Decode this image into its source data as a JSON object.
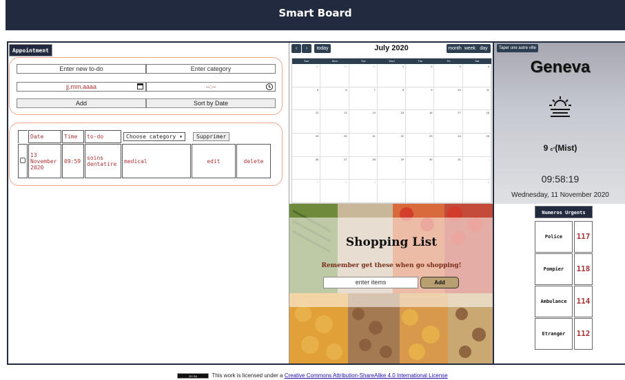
{
  "header": {
    "title": "Smart Board"
  },
  "appointment": {
    "tab_label": "Appointment",
    "todo_placeholder": "Enter new to-do",
    "category_placeholder": "Enter category",
    "date_placeholder": "jj.mm.aaaa",
    "time_placeholder": "--:--",
    "add_label": "Add",
    "sort_label": "Sort by Date",
    "table": {
      "headers": [
        "Date",
        "Time",
        "to-do"
      ],
      "category_select": "Choose category",
      "delete_all_label": "Supprimer",
      "rows": [
        {
          "date": "13 November 2020",
          "time": "09:59",
          "todo": "soins dentatire",
          "category": "medical",
          "edit": "edit",
          "delete": "delete"
        }
      ]
    }
  },
  "calendar": {
    "title": "July 2020",
    "prev_icon": "chevron-left-icon",
    "next_icon": "chevron-right-icon",
    "today_label": "today",
    "views": [
      "month",
      "week",
      "day"
    ],
    "weekdays": [
      "Sun",
      "Mon",
      "Tue",
      "Wed",
      "Thu",
      "Fri",
      "Sat"
    ],
    "weeks": [
      [
        "28",
        "29",
        "30",
        "1",
        "2",
        "3",
        "4"
      ],
      [
        "5",
        "6",
        "7",
        "8",
        "9",
        "10",
        "11"
      ],
      [
        "12",
        "13",
        "14",
        "15",
        "16",
        "17",
        "18"
      ],
      [
        "19",
        "20",
        "21",
        "22",
        "23",
        "24",
        "25"
      ],
      [
        "26",
        "27",
        "28",
        "29",
        "30",
        "31",
        "1"
      ],
      [
        "2",
        "3",
        "4",
        "5",
        "6",
        "7",
        "8"
      ]
    ]
  },
  "weather": {
    "city_button": "Taper une autre ville",
    "city": "Geneva",
    "icon": "sun-haze-icon",
    "temp_value": "9",
    "temp_unit": "c°",
    "condition": "Mist",
    "time": "09:58:19",
    "date": "Wednesday, 11 November 2020"
  },
  "shopping": {
    "title": "Shopping List",
    "subtitle": "Remember get these when go shopping!",
    "input_placeholder": "enter items",
    "add_label": "Add"
  },
  "urgent": {
    "title": "Numeros Urgents",
    "items": [
      {
        "label": "Police",
        "number": "117"
      },
      {
        "label": "Pompier",
        "number": "118"
      },
      {
        "label": "Ambulance",
        "number": "114"
      },
      {
        "label": "Etranger",
        "number": "112"
      }
    ]
  },
  "footer": {
    "badge": "BY-SA",
    "text": "This work is licensed under a",
    "link": "Creative Commons Attribution-ShareAlike 4.0 International License"
  }
}
